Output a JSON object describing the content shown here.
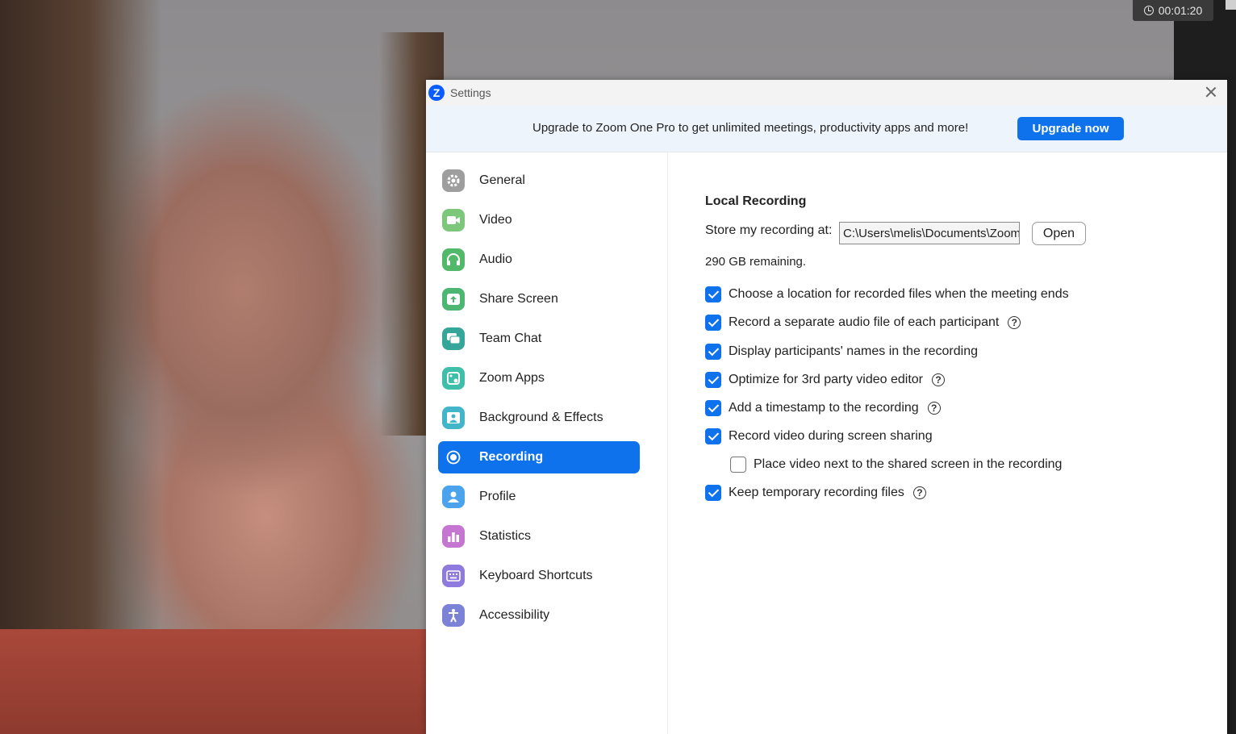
{
  "timer": {
    "elapsed": "00:01:20"
  },
  "window": {
    "app_icon": "Z",
    "title": "Settings"
  },
  "banner": {
    "text": "Upgrade to Zoom One Pro to get unlimited meetings, productivity apps and more!",
    "button": "Upgrade now"
  },
  "sidebar": {
    "items": [
      {
        "label": "General",
        "icon": "gear-icon",
        "color": "#9e9e9e"
      },
      {
        "label": "Video",
        "icon": "video-camera-icon",
        "color": "#7cc77a"
      },
      {
        "label": "Audio",
        "icon": "headphones-icon",
        "color": "#53b96a"
      },
      {
        "label": "Share Screen",
        "icon": "share-screen-icon",
        "color": "#4db673"
      },
      {
        "label": "Team Chat",
        "icon": "chat-icon",
        "color": "#37a69a"
      },
      {
        "label": "Zoom Apps",
        "icon": "zoom-apps-icon",
        "color": "#3fbfaa"
      },
      {
        "label": "Background & Effects",
        "icon": "background-icon",
        "color": "#42b6c8"
      },
      {
        "label": "Recording",
        "icon": "record-icon",
        "color": "#ffffff",
        "active": true
      },
      {
        "label": "Profile",
        "icon": "profile-icon",
        "color": "#4aa3ec"
      },
      {
        "label": "Statistics",
        "icon": "statistics-icon",
        "color": "#c576d0"
      },
      {
        "label": "Keyboard Shortcuts",
        "icon": "keyboard-icon",
        "color": "#8e7bdd"
      },
      {
        "label": "Accessibility",
        "icon": "accessibility-icon",
        "color": "#7c82d6"
      }
    ]
  },
  "recording": {
    "section_title": "Local Recording",
    "store_label": "Store my recording at:",
    "path": "C:\\Users\\melis\\Documents\\Zoom",
    "open_button": "Open",
    "remaining": "290 GB remaining.",
    "options": [
      {
        "label": "Choose a location for recorded files when the meeting ends",
        "checked": true,
        "help": false
      },
      {
        "label": "Record a separate audio file of each participant",
        "checked": true,
        "help": true
      },
      {
        "label": "Display participants' names in the recording",
        "checked": true,
        "help": false
      },
      {
        "label": "Optimize for 3rd party video editor",
        "checked": true,
        "help": true
      },
      {
        "label": "Add a timestamp to the recording",
        "checked": true,
        "help": true
      },
      {
        "label": "Record video during screen sharing",
        "checked": true,
        "help": false
      },
      {
        "label": "Place video next to the shared screen in the recording",
        "checked": false,
        "help": false
      },
      {
        "label": "Keep temporary recording files",
        "checked": true,
        "help": true
      }
    ],
    "help_glyph": "?"
  },
  "accent_color": "#0e72ed"
}
